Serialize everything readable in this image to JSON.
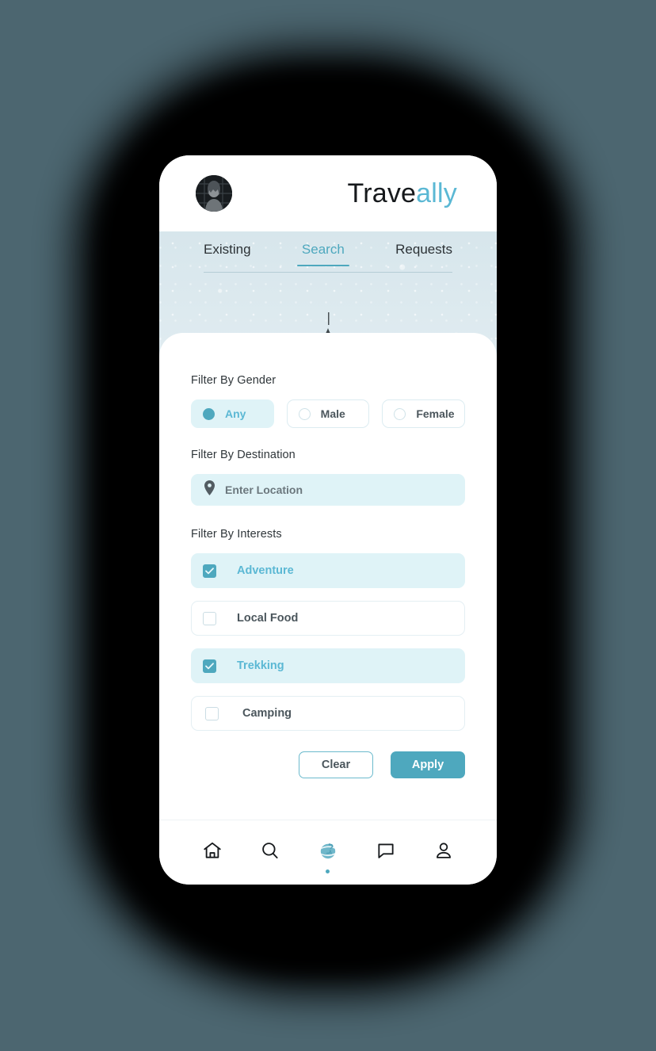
{
  "theme": {
    "page_background": "#4c6670",
    "accent": "#4ea8be",
    "accent_light": "#5bb8d4",
    "accent_tint": "#dff3f7",
    "text_dark": "#2f363a",
    "text_muted": "#4b565c"
  },
  "header": {
    "avatar_name": "user-avatar",
    "brand_first": "Trave",
    "brand_second": "ally"
  },
  "tabs": [
    {
      "label": "Existing",
      "active": false
    },
    {
      "label": "Search",
      "active": true
    },
    {
      "label": "Requests",
      "active": false
    }
  ],
  "filters": {
    "gender": {
      "label": "Filter By Gender",
      "options": [
        {
          "label": "Any",
          "selected": true
        },
        {
          "label": "Male",
          "selected": false
        },
        {
          "label": "Female",
          "selected": false
        }
      ]
    },
    "destination": {
      "label": "Filter By Destination",
      "icon": "map-pin-icon",
      "value": "",
      "placeholder": "Enter Location"
    },
    "interests": {
      "label": "Filter By Interests",
      "options": [
        {
          "label": "Adventure",
          "checked": true
        },
        {
          "label": "Local Food",
          "checked": false
        },
        {
          "label": "Trekking",
          "checked": true
        },
        {
          "label": "Camping",
          "checked": false
        }
      ]
    }
  },
  "actions": {
    "clear_label": "Clear",
    "apply_label": "Apply"
  },
  "bottom_nav": [
    {
      "icon": "home-icon",
      "active": false
    },
    {
      "icon": "search-icon",
      "active": false
    },
    {
      "icon": "globe-icon",
      "active": true
    },
    {
      "icon": "chat-icon",
      "active": false
    },
    {
      "icon": "profile-icon",
      "active": false
    }
  ]
}
